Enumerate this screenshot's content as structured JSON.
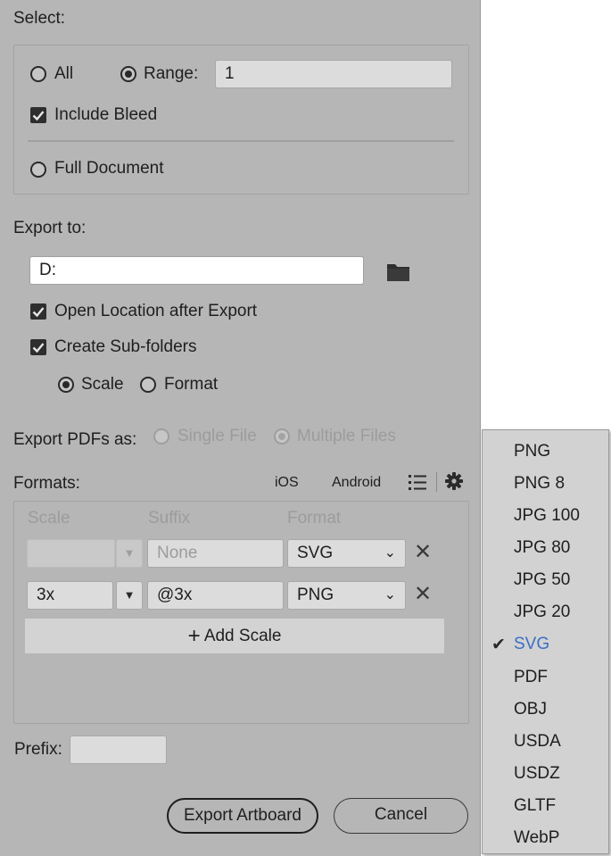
{
  "select": {
    "label": "Select:",
    "all_label": "All",
    "range_label": "Range:",
    "range_value": "1",
    "include_bleed_label": "Include Bleed",
    "full_document_label": "Full Document"
  },
  "export_to": {
    "label": "Export to:",
    "path_value": "D:",
    "open_location_label": "Open Location after Export",
    "create_subfolders_label": "Create Sub-folders",
    "scale_label": "Scale",
    "format_label": "Format"
  },
  "export_pdfs": {
    "label": "Export PDFs as:",
    "single_file_label": "Single File",
    "multiple_files_label": "Multiple Files"
  },
  "formats": {
    "label": "Formats:",
    "ios_label": "iOS",
    "android_label": "Android",
    "columns": {
      "scale": "Scale",
      "suffix": "Suffix",
      "format": "Format"
    },
    "rows": [
      {
        "scale": "",
        "suffix": "",
        "suffix_placeholder": "None",
        "format": "SVG"
      },
      {
        "scale": "3x",
        "suffix": "@3x",
        "suffix_placeholder": "",
        "format": "PNG"
      }
    ],
    "add_scale_label": "Add Scale"
  },
  "prefix": {
    "label": "Prefix:",
    "value": ""
  },
  "buttons": {
    "export_label": "Export Artboard",
    "cancel_label": "Cancel"
  },
  "format_menu": {
    "items": [
      "PNG",
      "PNG 8",
      "JPG 100",
      "JPG 80",
      "JPG 50",
      "JPG 20",
      "SVG",
      "PDF",
      "OBJ",
      "USDA",
      "USDZ",
      "GLTF",
      "WebP"
    ],
    "selected": "SVG"
  },
  "colors": {
    "panel_bg": "#b6b6b6",
    "selected_item": "#3a6fc4"
  }
}
